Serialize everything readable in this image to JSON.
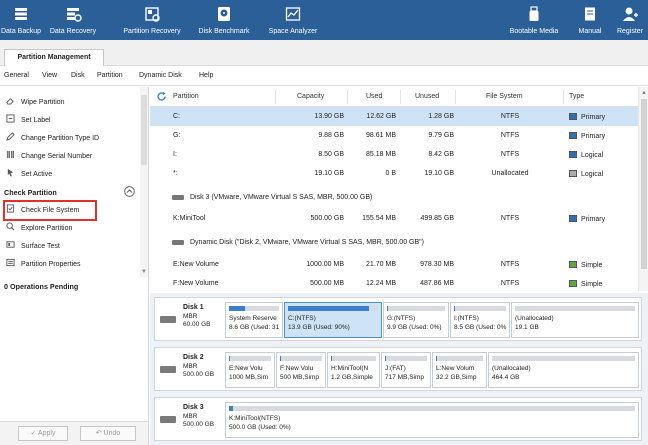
{
  "toolbar": {
    "items": [
      {
        "label": "Data Backup",
        "icon": "data-backup-icon"
      },
      {
        "label": "Data Recovery",
        "icon": "data-recovery-icon"
      },
      {
        "label": "Partition Recovery",
        "icon": "partition-recovery-icon"
      },
      {
        "label": "Disk Benchmark",
        "icon": "disk-benchmark-icon"
      },
      {
        "label": "Space Analyzer",
        "icon": "space-analyzer-icon"
      },
      {
        "label": "Bootable Media",
        "icon": "bootable-media-icon"
      },
      {
        "label": "Manual",
        "icon": "manual-icon"
      },
      {
        "label": "Register",
        "icon": "register-icon"
      }
    ]
  },
  "tabs": {
    "active": "Partition Management"
  },
  "menu": [
    "General",
    "View",
    "Disk",
    "Partition",
    "Dynamic Disk",
    "Help"
  ],
  "left_panel": {
    "items_top": [
      "Wipe Partition",
      "Set Label",
      "Change Partition Type ID",
      "Change Serial Number",
      "Set Active"
    ],
    "check_header": "Check Partition",
    "items_check": [
      "Check File System",
      "Explore Partition",
      "Surface Test",
      "Partition Properties"
    ],
    "pending": "0 Operations Pending",
    "apply": "Apply",
    "undo": "Undo"
  },
  "table": {
    "headers": [
      "Partition",
      "Capacity",
      "Used",
      "Unused",
      "File System",
      "Type"
    ],
    "rows": [
      {
        "partition": "C:",
        "capacity": "13.90 GB",
        "used": "12.62 GB",
        "unused": "1.28 GB",
        "fs": "NTFS",
        "type": "Primary",
        "color": "#2f6fb3"
      },
      {
        "partition": "G:",
        "capacity": "9.88 GB",
        "used": "98.61 MB",
        "unused": "9.79 GB",
        "fs": "NTFS",
        "type": "Primary",
        "color": "#2f6fb3"
      },
      {
        "partition": "I:",
        "capacity": "8.50 GB",
        "used": "85.18 MB",
        "unused": "8.42 GB",
        "fs": "NTFS",
        "type": "Logical",
        "color": "#2f6fb3"
      },
      {
        "partition": "*:",
        "capacity": "19.10 GB",
        "used": "0 B",
        "unused": "19.10 GB",
        "fs": "Unallocated",
        "type": "Logical",
        "color": "#aaaaaa"
      }
    ],
    "disk3_label": "Disk 3 (VMware, VMware Virtual S SAS, MBR, 500.00 GB)",
    "disk3_row": {
      "partition": "K:MiniTool",
      "capacity": "500.00 GB",
      "used": "155.54 MB",
      "unused": "499.85 GB",
      "fs": "NTFS",
      "type": "Primary",
      "color": "#2f6fb3"
    },
    "dynamic_label": "Dynamic Disk (\"Disk 2, VMware, VMware Virtual S SAS, MBR, 500.00 GB\")",
    "dyn_rows": [
      {
        "partition": "E:New Volume",
        "capacity": "1000.00 MB",
        "used": "21.70 MB",
        "unused": "978.30 MB",
        "fs": "NTFS",
        "type": "Simple",
        "color": "#5fa83c"
      },
      {
        "partition": "F:New Volume",
        "capacity": "500.00 MB",
        "used": "12.24 MB",
        "unused": "487.86 MB",
        "fs": "NTFS",
        "type": "Simple",
        "color": "#5fa83c"
      }
    ]
  },
  "disks": [
    {
      "name": "Disk 1",
      "type": "MBR",
      "size": "60.00 GB",
      "parts": [
        {
          "l1": "System Reserve",
          "l2": "8.6 GB (Used: 31",
          "fill": 0.31
        },
        {
          "l1": "C:(NTFS)",
          "l2": "13.9 GB (Used: 90%)",
          "fill": 0.9
        },
        {
          "l1": "G:(NTFS)",
          "l2": "9.9 GB (Used: 0%)",
          "fill": 0.01
        },
        {
          "l1": "I:(NTFS)",
          "l2": "8.5 GB (Used: 0%",
          "fill": 0.01
        },
        {
          "l1": "(Unallocated)",
          "l2": "19.1 GB",
          "fill": 0
        }
      ]
    },
    {
      "name": "Disk 2",
      "type": "MBR",
      "size": "500.00 GB",
      "parts": [
        {
          "l1": "E:New Volu",
          "l2": "1000 MB,Sim",
          "fill": 0.02
        },
        {
          "l1": "F:New Volu",
          "l2": "500 MB,Simp",
          "fill": 0.02
        },
        {
          "l1": "H:MiniTool(N",
          "l2": "1.2 GB,Simple",
          "fill": 0.02
        },
        {
          "l1": "J:(FAT)",
          "l2": "717 MB,Simp",
          "fill": 0.02
        },
        {
          "l1": "L:New Volum",
          "l2": "32.2 GB,Simp",
          "fill": 0.02
        },
        {
          "l1": "(Unallocated)",
          "l2": "464.4 GB",
          "fill": 0
        }
      ]
    },
    {
      "name": "Disk 3",
      "type": "MBR",
      "size": "500.00 GB",
      "parts": [
        {
          "l1": "K:MiniTool(NTFS)",
          "l2": "500.0 GB (Used: 0%)",
          "fill": 0.01
        }
      ]
    }
  ]
}
